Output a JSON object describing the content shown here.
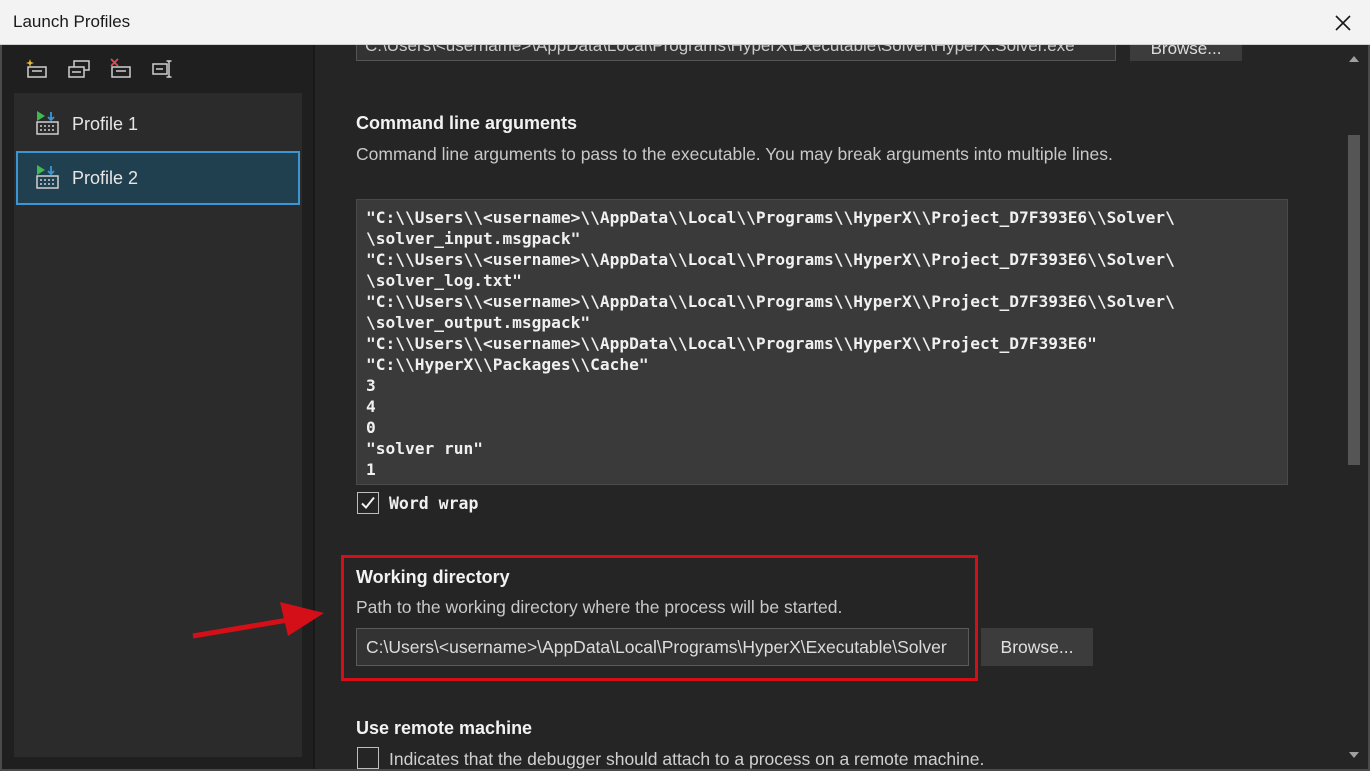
{
  "window": {
    "title": "Launch Profiles"
  },
  "toolbar": {
    "icons": [
      "new-profile-icon",
      "copy-profile-icon",
      "delete-profile-icon",
      "rename-profile-icon"
    ]
  },
  "profiles": [
    {
      "label": "Profile 1",
      "selected": false
    },
    {
      "label": "Profile 2",
      "selected": true
    }
  ],
  "executable": {
    "path": "C:\\Users\\<username>\\AppData\\Local\\Programs\\HyperX\\Executable\\Solver\\HyperX.Solver.exe",
    "browse_label": "Browse..."
  },
  "command_line": {
    "title": "Command line arguments",
    "description": "Command line arguments to pass to the executable. You may break arguments into multiple lines.",
    "lines": [
      "\"C:\\\\Users\\\\<username>\\\\AppData\\\\Local\\\\Programs\\\\HyperX\\\\Project_D7F393E6\\\\Solver\\",
      "\\solver_input.msgpack\"",
      "\"C:\\\\Users\\\\<username>\\\\AppData\\\\Local\\\\Programs\\\\HyperX\\\\Project_D7F393E6\\\\Solver\\",
      "\\solver_log.txt\"",
      "\"C:\\\\Users\\\\<username>\\\\AppData\\\\Local\\\\Programs\\\\HyperX\\\\Project_D7F393E6\\\\Solver\\",
      "\\solver_output.msgpack\"",
      "\"C:\\\\Users\\\\<username>\\\\AppData\\\\Local\\\\Programs\\\\HyperX\\\\Project_D7F393E6\"",
      "\"C:\\\\HyperX\\\\Packages\\\\Cache\"",
      "3",
      "4",
      "0",
      "\"solver run\"",
      "1"
    ],
    "word_wrap_label": "Word wrap",
    "word_wrap_checked": true
  },
  "working_directory": {
    "title": "Working directory",
    "description": "Path to the working directory where the process will be started.",
    "value": "C:\\Users\\<username>\\AppData\\Local\\Programs\\HyperX\\Executable\\Solver",
    "browse_label": "Browse..."
  },
  "remote_machine": {
    "title": "Use remote machine",
    "description": "Indicates that the debugger should attach to a process on a remote machine.",
    "checked": false
  },
  "colors": {
    "highlight": "#d40f17",
    "selection_border": "#3c96d4",
    "selection_bg": "#21404f"
  }
}
